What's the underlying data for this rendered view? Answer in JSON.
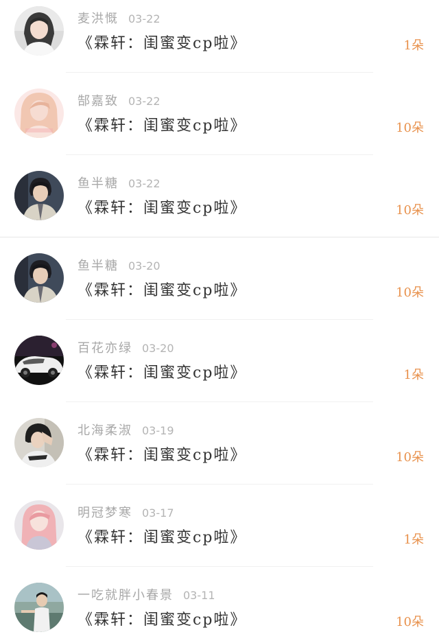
{
  "gift_list": [
    {
      "avatar": "avatar-icon",
      "name": "麦洪慨",
      "date": "03-22",
      "title": "《霖轩：闺蜜变cp啦》",
      "count": "1朵"
    },
    {
      "avatar": "avatar-icon",
      "name": "郜嘉致",
      "date": "03-22",
      "title": "《霖轩：闺蜜变cp啦》",
      "count": "10朵"
    },
    {
      "avatar": "avatar-icon",
      "name": "鱼半糖",
      "date": "03-22",
      "title": "《霖轩：闺蜜变cp啦》",
      "count": "10朵"
    },
    {
      "avatar": "avatar-icon",
      "name": "鱼半糖",
      "date": "03-20",
      "title": "《霖轩：闺蜜变cp啦》",
      "count": "10朵"
    },
    {
      "avatar": "avatar-icon",
      "name": "百花亦绿",
      "date": "03-20",
      "title": "《霖轩：闺蜜变cp啦》",
      "count": "1朵"
    },
    {
      "avatar": "avatar-icon",
      "name": "北海柔淑",
      "date": "03-19",
      "title": "《霖轩：闺蜜变cp啦》",
      "count": "10朵"
    },
    {
      "avatar": "avatar-icon",
      "name": "明冠梦寒",
      "date": "03-17",
      "title": "《霖轩：闺蜜变cp啦》",
      "count": "1朵"
    },
    {
      "avatar": "avatar-icon",
      "name": "一吃就胖小春景",
      "date": "03-11",
      "title": "《霖轩：闺蜜变cp啦》",
      "count": "10朵"
    }
  ],
  "colors": {
    "name_text": "#a8a8a8",
    "date_text": "#b4b4b4",
    "title_text": "#333333",
    "count_text": "#e8914c",
    "divider": "#f0f0f0"
  }
}
